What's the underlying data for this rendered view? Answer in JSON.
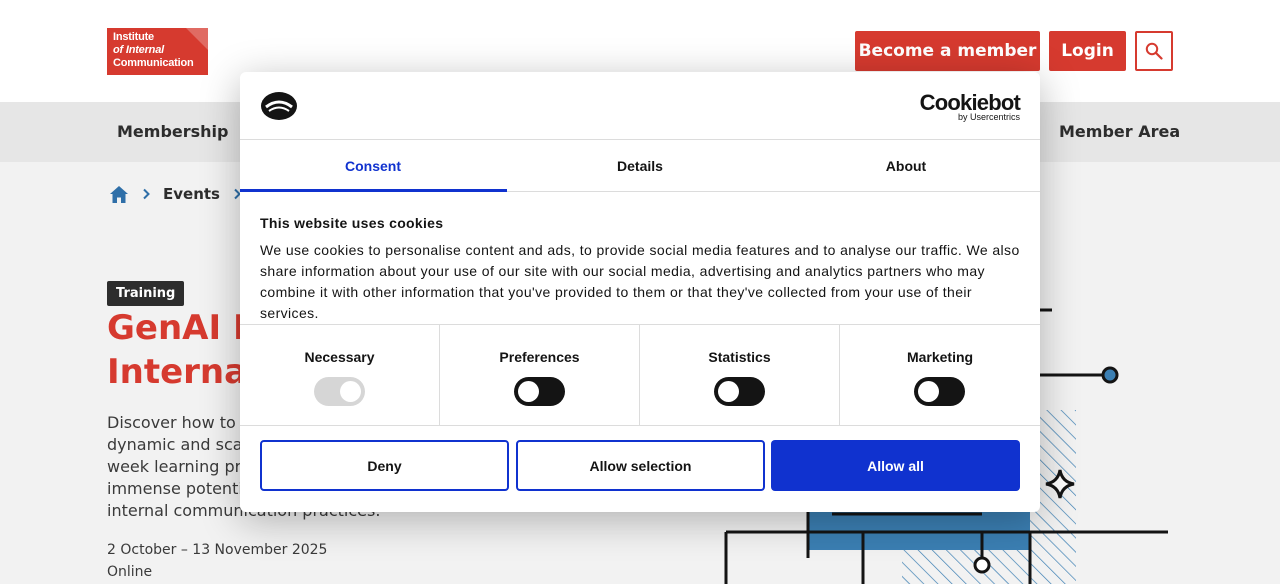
{
  "logo": {
    "line1": "Institute",
    "line2": "of Internal",
    "line3": "Communication"
  },
  "header": {
    "member_label": "Become a member",
    "login_label": "Login"
  },
  "nav": {
    "items": [
      {
        "label": "Membership"
      },
      {
        "label": "Member Area"
      }
    ]
  },
  "breadcrumb": {
    "items": [
      {
        "label": "Events"
      }
    ]
  },
  "hero": {
    "tag": "Training",
    "title": "GenAI Ma… Internal C…",
    "title_line1": "GenAI Ma",
    "title_line2": "Internal C",
    "desc_line1": "Discover how to us",
    "desc_line2": "dynamic and scalab",
    "desc_line3": "week learning prog",
    "desc_line4": "immense potential",
    "desc_line5": "internal communication practices.",
    "date": "2 October – 13 November 2025",
    "location": "Online"
  },
  "cookie": {
    "brand_name": "Cookiebot",
    "brand_sub": "by Usercentrics",
    "tabs": [
      {
        "label": "Consent"
      },
      {
        "label": "Details"
      },
      {
        "label": "About"
      }
    ],
    "title": "This website uses cookies",
    "text": "We use cookies to personalise content and ads, to provide social media features and to analyse our traffic. We also share information about your use of our site with our social media, advertising and analytics partners who may combine it with other information that you've provided to them or that they've collected from your use of their services.",
    "categories": [
      {
        "label": "Necessary",
        "enabled": true,
        "disabled": true
      },
      {
        "label": "Preferences",
        "enabled": false
      },
      {
        "label": "Statistics",
        "enabled": false
      },
      {
        "label": "Marketing",
        "enabled": false
      }
    ],
    "buttons": {
      "deny": "Deny",
      "selection": "Allow selection",
      "all": "Allow all"
    }
  },
  "colors": {
    "brand_red": "#d63a2f",
    "cookie_blue": "#1032cf",
    "dark": "#141414"
  }
}
